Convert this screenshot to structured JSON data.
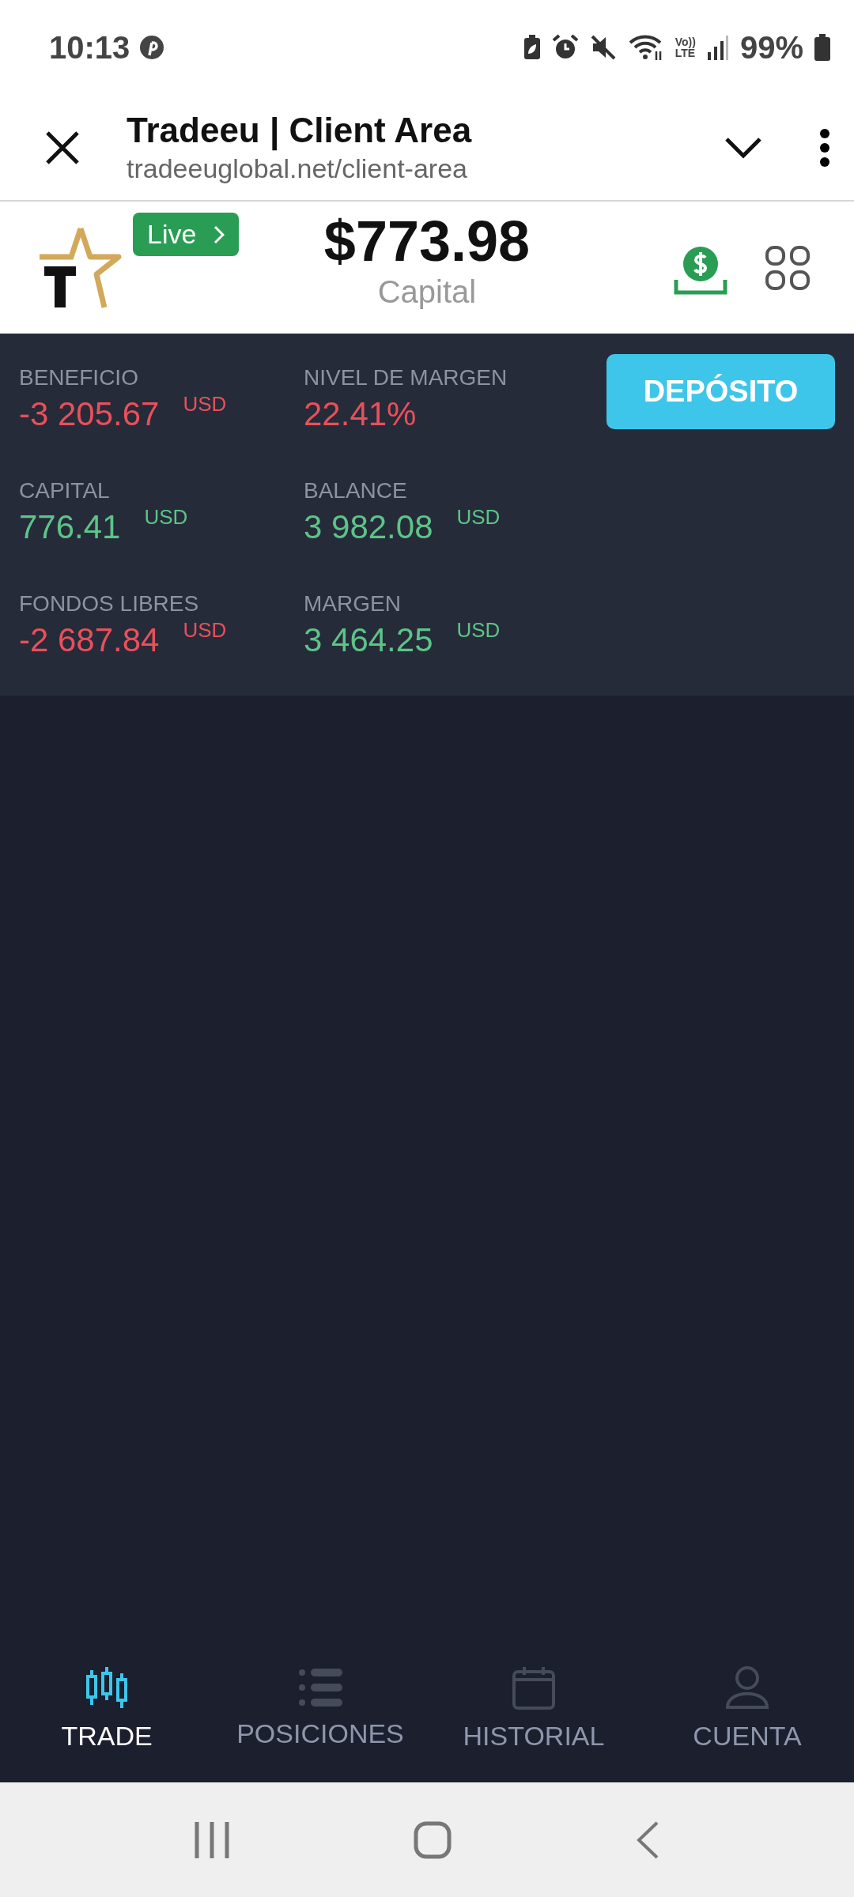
{
  "status_bar": {
    "time": "10:13",
    "network": [
      "Vo))",
      "LTE"
    ],
    "battery": "99%"
  },
  "browser_bar": {
    "title": "Tradeeu | Client Area",
    "url": "tradeeuglobal.net/client-area"
  },
  "header": {
    "badge": "Live",
    "amount": "$773.98",
    "amount_label": "Capital"
  },
  "stats": [
    {
      "label": "BENEFICIO",
      "value": "-3 205.67",
      "unit": "USD",
      "color": "#e8505b"
    },
    {
      "label": "NIVEL DE MARGEN",
      "value": "22.41%",
      "color": "#e8505b"
    },
    {
      "label": "CAPITAL",
      "value": "776.41",
      "unit": "USD",
      "color": "#5cc488"
    },
    {
      "label": "BALANCE",
      "value": "3 982.08",
      "unit": "USD",
      "color": "#5cc488"
    },
    {
      "label": "FONDOS LIBRES",
      "value": "-2 687.84",
      "unit": "USD",
      "color": "#e8505b"
    },
    {
      "label": "MARGEN",
      "value": "3 464.25",
      "unit": "USD",
      "color": "#5cc488"
    }
  ],
  "deposit_button": "DEPÓSITO",
  "bottom_nav": [
    {
      "kind": "candles",
      "label": "TRADE",
      "selected": true
    },
    {
      "kind": "list",
      "label": "POSICIONES",
      "selected": false
    },
    {
      "kind": "calendar",
      "label": "HISTORIAL",
      "selected": false
    },
    {
      "kind": "person",
      "label": "CUENTA",
      "selected": false
    }
  ]
}
